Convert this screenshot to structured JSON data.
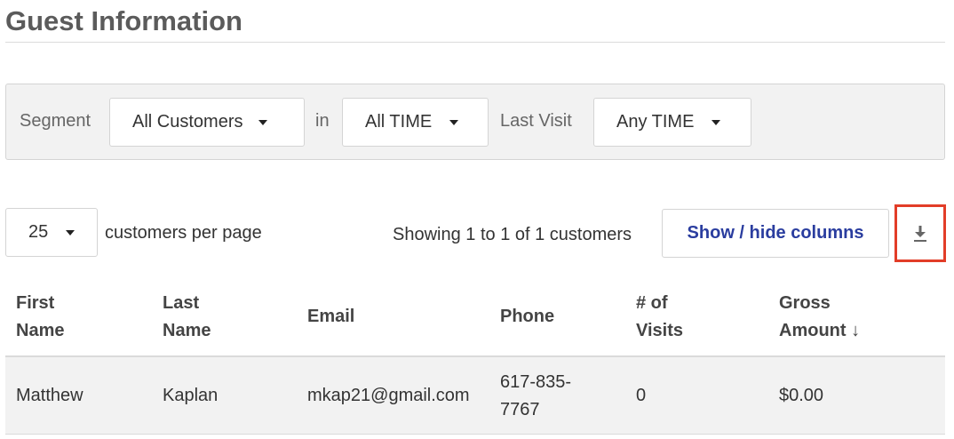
{
  "page": {
    "title": "Guest Information"
  },
  "filters": {
    "segment_label": "Segment",
    "segment_value": "All Customers",
    "in_label": "in",
    "time_value": "All TIME",
    "last_visit_label": "Last Visit",
    "last_visit_value": "Any TIME"
  },
  "pagination": {
    "per_page_value": "25",
    "per_page_label": "customers per page",
    "showing_text": "Showing 1 to 1 of 1 customers"
  },
  "toolbar": {
    "show_hide_label": "Show / hide columns",
    "download_icon": "download-icon",
    "highlight_color": "#e23d28"
  },
  "table": {
    "headers": {
      "first_name": [
        "First",
        "Name"
      ],
      "last_name": [
        "Last",
        "Name"
      ],
      "email": "Email",
      "phone": "Phone",
      "visits": [
        "# of",
        "Visits"
      ],
      "gross": [
        "Gross",
        "Amount ↓"
      ]
    },
    "rows": [
      {
        "first_name": "Matthew",
        "last_name": "Kaplan",
        "email": "mkap21@gmail.com",
        "phone": [
          "617-835-",
          "7767"
        ],
        "visits": "0",
        "gross": "$0.00"
      }
    ]
  }
}
